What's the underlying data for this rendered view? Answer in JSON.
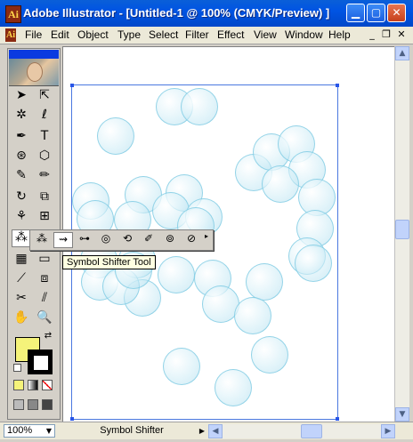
{
  "window": {
    "title": "Adobe Illustrator - [Untitled-1 @ 100% (CMYK/Preview) ]",
    "app_icon_glyph": "Ai",
    "minimize_icon": "minimize-icon",
    "maximize_icon": "maximize-icon",
    "close_icon": "close-icon"
  },
  "menubar": {
    "items": [
      "File",
      "Edit",
      "Object",
      "Type",
      "Select",
      "Filter",
      "Effect",
      "View",
      "Window",
      "Help"
    ]
  },
  "toolbox": {
    "tools": [
      "selection-tool",
      "direct-selection-tool",
      "magic-wand-tool",
      "lasso-tool",
      "pen-tool",
      "type-tool",
      "line-segment-tool",
      "rectangle-tool",
      "paintbrush-tool",
      "pencil-tool",
      "rotate-tool",
      "scale-tool",
      "warp-tool",
      "free-transform-tool",
      "symbol-sprayer-tool",
      "column-graph-tool",
      "mesh-tool",
      "gradient-tool",
      "eyedropper-tool",
      "blend-tool",
      "scissors-tool",
      "slice-tool",
      "hand-tool",
      "zoom-tool"
    ],
    "fill_color": "#f5f37a",
    "stroke_color": "#000000"
  },
  "flyout": {
    "tools": [
      "symbol-sprayer-icon",
      "symbol-shifter-icon",
      "symbol-scruncher-icon",
      "symbol-sizer-icon",
      "symbol-spinner-icon",
      "symbol-stainer-icon",
      "symbol-screener-icon",
      "symbol-styler-icon"
    ],
    "selected_index": 1,
    "tooltip": "Symbol Shifter Tool"
  },
  "statusbar": {
    "zoom": "100%",
    "status_text": "Symbol Shifter"
  },
  "colors": {
    "bubble_stroke": "#78c8e1",
    "artboard_border": "#4a78e0",
    "title_bar": "#0054e3"
  }
}
